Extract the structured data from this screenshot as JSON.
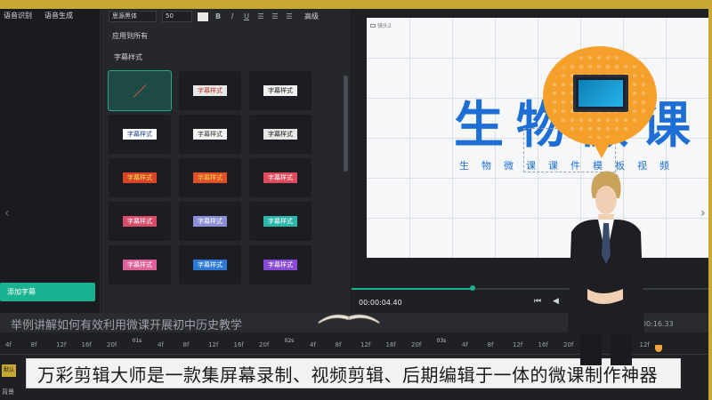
{
  "left_panel": {
    "tabs": [
      "语音识别",
      "语音生成"
    ],
    "add_subtitle_button": "添加字幕"
  },
  "format_bar": {
    "font": "思源黑体",
    "size": "50",
    "bold": "B",
    "italic": "I",
    "underline": "U",
    "advanced": "高级"
  },
  "apply_all": "应用到所有",
  "subtitle_styles_label": "字幕样式",
  "style_tiles": [
    {
      "label": "",
      "bg": "none",
      "fg": "none"
    },
    {
      "label": "字幕样式",
      "bg": "#e8e8e8",
      "fg": "#c0392b"
    },
    {
      "label": "字幕样式",
      "bg": "#f0f0f0",
      "fg": "#222222"
    },
    {
      "label": "字幕样式",
      "bg": "#ffffff",
      "fg": "#1a3f8a"
    },
    {
      "label": "字幕样式",
      "bg": "#f3f3f3",
      "fg": "#3a3a3a"
    },
    {
      "label": "字幕样式",
      "bg": "#e6e6e6",
      "fg": "#222222"
    },
    {
      "label": "字幕样式",
      "bg": "#d9432a",
      "fg": "#ffe24a"
    },
    {
      "label": "字幕样式",
      "bg": "#e0502a",
      "fg": "#ffd24a"
    },
    {
      "label": "字幕样式",
      "bg": "#e04a5a",
      "fg": "#ffffff"
    },
    {
      "label": "字幕样式",
      "bg": "#d64d6a",
      "fg": "#ffffff"
    },
    {
      "label": "字幕样式",
      "bg": "#8c8fd6",
      "fg": "#ffffff"
    },
    {
      "label": "字幕样式",
      "bg": "#2ab6a8",
      "fg": "#ffffff"
    },
    {
      "label": "字幕样式",
      "bg": "#e0609a",
      "fg": "#ffffff"
    },
    {
      "label": "字幕样式",
      "bg": "#2c79d6",
      "fg": "#ffffff"
    },
    {
      "label": "字幕样式",
      "bg": "#8a4ad6",
      "fg": "#ffffff"
    }
  ],
  "preview": {
    "lens_label": "镜头2",
    "main_title": "生物微课",
    "subtitle_chars": "生物微课课件模板视频",
    "current_time": "00:00:04.40",
    "playback_progress_fraction": 0.34
  },
  "timeline": {
    "title": "举例讲解如何有效利用微课开展初中历史教学",
    "total_time": "00:00:16.33",
    "ruler_labels": [
      "4f",
      "8f",
      "12f",
      "16f",
      "20f",
      "01s",
      "4f",
      "8f",
      "12f",
      "16f",
      "20f",
      "02s",
      "4f",
      "8f",
      "12f",
      "16f",
      "20f",
      "03s",
      "4f",
      "8f",
      "12f",
      "16f",
      "20f",
      "4f",
      "8f",
      "12f"
    ],
    "side_button": "默认",
    "track_label": "背景"
  },
  "caption": "万彩剪辑大师是一款集屏幕录制、视频剪辑、后期编辑于一体的微课制作神器"
}
